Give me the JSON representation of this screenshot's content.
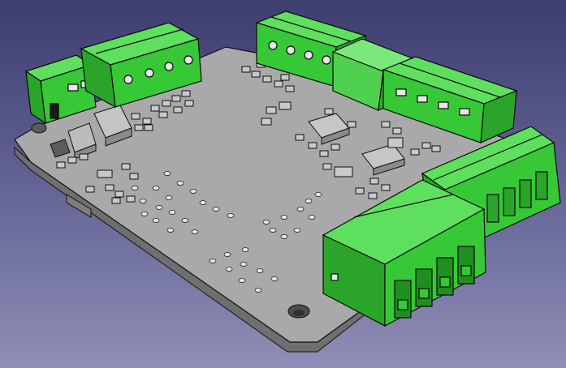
{
  "viewport": {
    "background_top": "#3d3d6e",
    "background_bottom": "#8e8eb6"
  },
  "model": {
    "type": "pcb-assembly",
    "board_color": "#a9a9a9",
    "board_edge_color": "#e2e2e2",
    "component_color": "#c7c7c7",
    "connector_color": "#37c837",
    "connector_dark": "#1f8f1f",
    "connector_light": "#5ee05e"
  }
}
